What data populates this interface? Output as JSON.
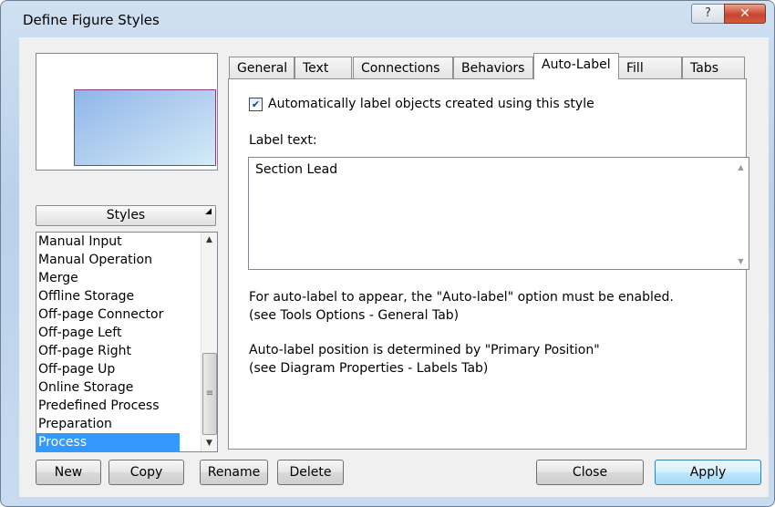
{
  "window": {
    "title": "Define Figure Styles",
    "help_glyph": "?",
    "close_glyph": "✕"
  },
  "styles_button": {
    "label": "Styles",
    "arrow_glyph": "◢"
  },
  "styles_list": {
    "items": [
      "Manual Input",
      "Manual Operation",
      "Merge",
      "Offline Storage",
      "Off-page Connector",
      "Off-page Left",
      "Off-page Right",
      "Off-page Up",
      "Online Storage",
      "Predefined Process",
      "Preparation",
      "Process"
    ],
    "selected": "Process",
    "scroll_up_glyph": "▲",
    "scroll_down_glyph": "▼",
    "thumb_glyph": "≡"
  },
  "tabs": [
    "General",
    "Text",
    "Connections",
    "Behaviors",
    "Auto-Label",
    "Fill",
    "Tabs"
  ],
  "active_tab": "Auto-Label",
  "auto_label": {
    "checkbox_label": "Automatically label objects created using this style",
    "checked": true,
    "check_glyph": "✔",
    "label_text_caption": "Label text:",
    "label_text_value": "Section Lead",
    "scroll_up_glyph": "▲",
    "scroll_down_glyph": "▼",
    "info1_line1": "For auto-label to appear, the \"Auto-label\" option must be enabled.",
    "info1_line2": "(see Tools Options - General Tab)",
    "info2_line1": "Auto-label position is determined by \"Primary Position\"",
    "info2_line2": "(see Diagram Properties - Labels Tab)"
  },
  "buttons": {
    "new": "New",
    "copy": "Copy",
    "rename": "Rename",
    "delete": "Delete",
    "close": "Close",
    "apply": "Apply"
  },
  "colors": {
    "selection": "#3399ff",
    "accent": "#3c7fb1",
    "shape_border": "#8a3b8a"
  }
}
